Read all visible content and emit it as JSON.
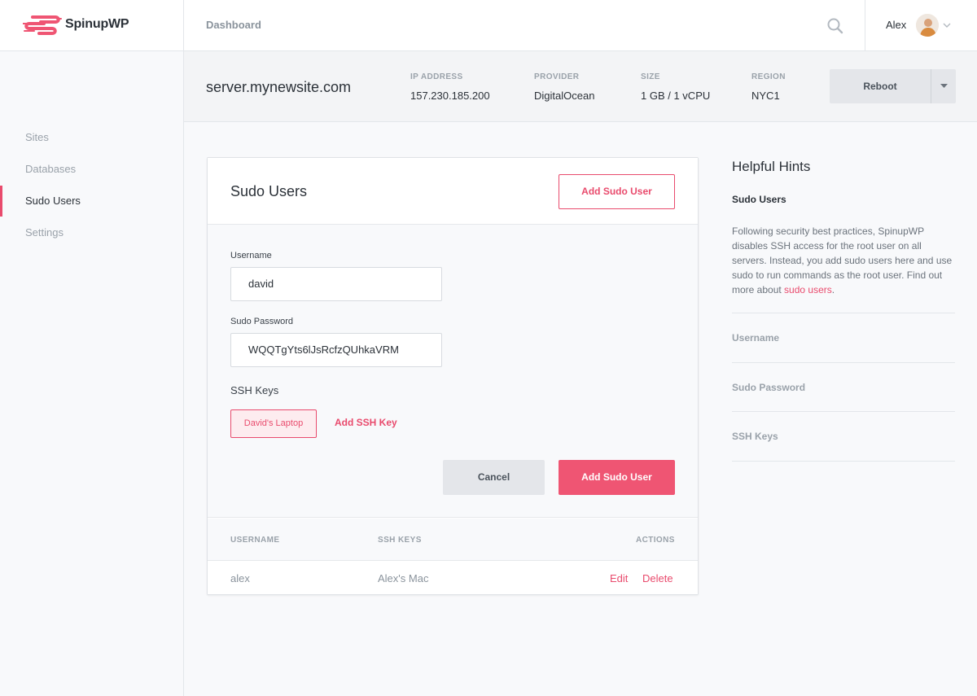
{
  "app": {
    "name": "SpinupWP"
  },
  "header": {
    "breadcrumb": "Dashboard",
    "user_name": "Alex"
  },
  "sidebar": {
    "items": [
      {
        "label": "Sites",
        "active": false
      },
      {
        "label": "Databases",
        "active": false
      },
      {
        "label": "Sudo Users",
        "active": true
      },
      {
        "label": "Settings",
        "active": false
      }
    ]
  },
  "server": {
    "name": "server.mynewsite.com",
    "meta": [
      {
        "label": "IP ADDRESS",
        "value": "157.230.185.200"
      },
      {
        "label": "PROVIDER",
        "value": "DigitalOcean"
      },
      {
        "label": "SIZE",
        "value": "1 GB / 1 vCPU"
      },
      {
        "label": "REGION",
        "value": "NYC1"
      }
    ],
    "reboot_label": "Reboot"
  },
  "sudo_users": {
    "title": "Sudo Users",
    "add_button": "Add Sudo User",
    "form": {
      "username_label": "Username",
      "username_value": "david",
      "password_label": "Sudo Password",
      "password_value": "WQQTgYts6lJsRcfzQUhkaVRM",
      "ssh_keys_label": "SSH Keys",
      "ssh_key_chip": "David's Laptop",
      "add_ssh_key": "Add SSH Key",
      "cancel": "Cancel",
      "submit": "Add Sudo User"
    },
    "table": {
      "columns": [
        "USERNAME",
        "SSH KEYS",
        "ACTIONS"
      ],
      "rows": [
        {
          "username": "alex",
          "ssh_keys": "Alex's Mac",
          "edit": "Edit",
          "delete": "Delete"
        }
      ]
    }
  },
  "hints": {
    "title": "Helpful Hints",
    "subtitle": "Sudo Users",
    "body": "Following security best practices, SpinupWP disables SSH access for the root user on all servers. Instead, you add sudo users here and use sudo to run commands as the root user. Find out more about ",
    "link": "sudo users",
    "body_end": ".",
    "items": [
      "Username",
      "Sudo Password",
      "SSH Keys"
    ]
  },
  "colors": {
    "accent": "#e94b6d",
    "primary_button": "#ef5573"
  }
}
